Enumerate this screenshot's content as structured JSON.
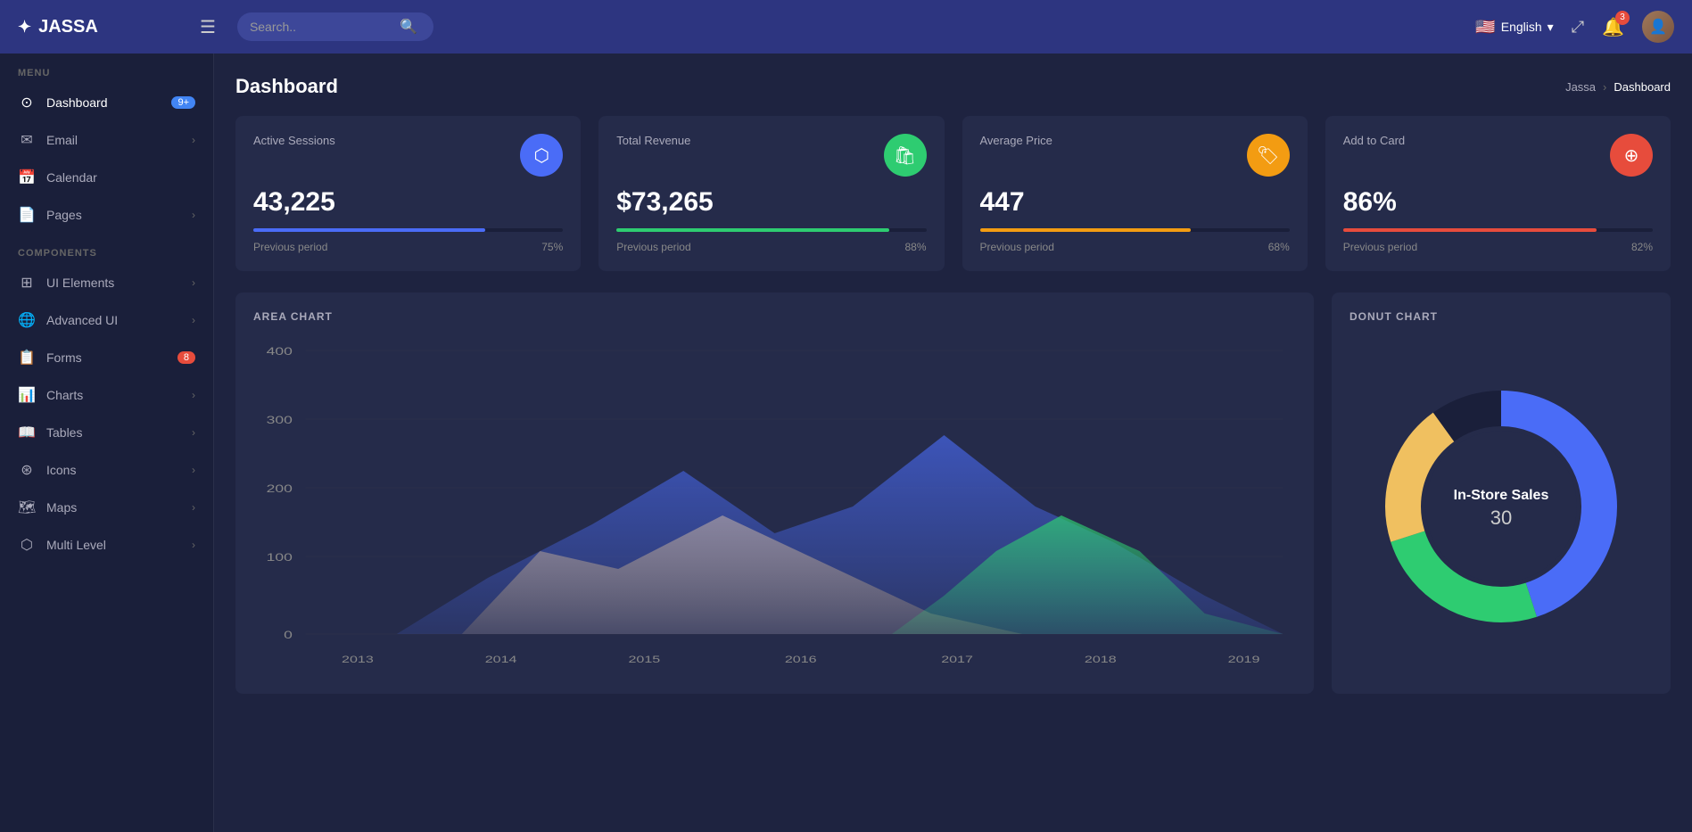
{
  "app": {
    "logo_icon": "✦",
    "logo_name": "JASSA",
    "hamburger_icon": "☰",
    "search_placeholder": "Search..",
    "search_icon": "🔍"
  },
  "topnav": {
    "language": "English",
    "flag": "🇺🇸",
    "chevron": "▾",
    "fullscreen_icon": "⤢",
    "notif_icon": "🔔",
    "notif_count": "3",
    "avatar_initials": "👤"
  },
  "sidebar": {
    "section_menu": "MENU",
    "section_components": "COMPONENTS",
    "items": [
      {
        "id": "dashboard",
        "icon": "⊙",
        "label": "Dashboard",
        "badge": "9+",
        "badge_color": "blue",
        "arrow": ""
      },
      {
        "id": "email",
        "icon": "✉",
        "label": "Email",
        "badge": "",
        "arrow": "›"
      },
      {
        "id": "calendar",
        "icon": "📅",
        "label": "Calendar",
        "badge": "",
        "arrow": ""
      },
      {
        "id": "pages",
        "icon": "📄",
        "label": "Pages",
        "badge": "",
        "arrow": "›"
      },
      {
        "id": "ui-elements",
        "icon": "⊞",
        "label": "UI Elements",
        "badge": "",
        "arrow": "›"
      },
      {
        "id": "advanced-ui",
        "icon": "🌐",
        "label": "Advanced UI",
        "badge": "",
        "arrow": "›"
      },
      {
        "id": "forms",
        "icon": "📋",
        "label": "Forms",
        "badge": "8",
        "badge_color": "red",
        "arrow": ""
      },
      {
        "id": "charts",
        "icon": "📊",
        "label": "Charts",
        "badge": "",
        "arrow": "›"
      },
      {
        "id": "tables",
        "icon": "📖",
        "label": "Tables",
        "badge": "",
        "arrow": "›"
      },
      {
        "id": "icons",
        "icon": "⊛",
        "label": "Icons",
        "badge": "",
        "arrow": "›"
      },
      {
        "id": "maps",
        "icon": "🗺",
        "label": "Maps",
        "badge": "",
        "arrow": "›"
      },
      {
        "id": "multi-level",
        "icon": "⬡",
        "label": "Multi Level",
        "badge": "",
        "arrow": "›"
      }
    ]
  },
  "breadcrumb": {
    "home": "Jassa",
    "separator": "›",
    "current": "Dashboard"
  },
  "page_title": "Dashboard",
  "stat_cards": [
    {
      "title": "Active Sessions",
      "value": "43,225",
      "icon": "⬡",
      "icon_color": "blue",
      "bar_color": "blue",
      "bar_pct": 75,
      "period_label": "Previous period",
      "period_value": "75%"
    },
    {
      "title": "Total Revenue",
      "value": "$73,265",
      "icon": "🛍",
      "icon_color": "green",
      "bar_color": "green",
      "bar_pct": 88,
      "period_label": "Previous period",
      "period_value": "88%"
    },
    {
      "title": "Average Price",
      "value": "447",
      "icon": "🏷",
      "icon_color": "yellow",
      "bar_color": "yellow",
      "bar_pct": 68,
      "period_label": "Previous period",
      "period_value": "68%"
    },
    {
      "title": "Add to Card",
      "value": "86%",
      "icon": "⊕",
      "icon_color": "red",
      "bar_color": "red",
      "bar_pct": 82,
      "period_label": "Previous period",
      "period_value": "82%"
    }
  ],
  "area_chart": {
    "title": "AREA CHART",
    "y_labels": [
      "400",
      "300",
      "200",
      "100",
      "0"
    ],
    "x_labels": [
      "2013",
      "2014",
      "2015",
      "2016",
      "2017",
      "2018",
      "2019"
    ]
  },
  "donut_chart": {
    "title": "DONUT CHART",
    "center_label": "In-Store Sales",
    "center_value": "30",
    "segments": [
      {
        "color": "#4a6cf7",
        "pct": 45
      },
      {
        "color": "#2ecc71",
        "pct": 25
      },
      {
        "color": "#f39c12",
        "pct": 20
      },
      {
        "color": "#1a1f3a",
        "pct": 10
      }
    ]
  }
}
